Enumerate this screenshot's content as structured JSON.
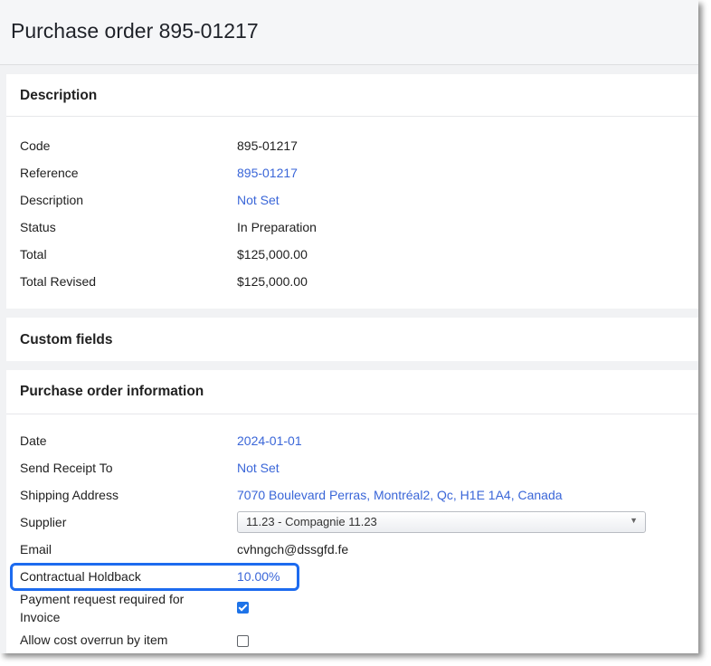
{
  "header": {
    "title": "Purchase order 895-01217"
  },
  "description": {
    "title": "Description",
    "rows": [
      {
        "label": "Code",
        "value": "895-01217"
      },
      {
        "label": "Reference",
        "value": "895-01217"
      },
      {
        "label": "Description",
        "value": "Not Set"
      },
      {
        "label": "Status",
        "value": "In Preparation"
      },
      {
        "label": "Total",
        "value": "$125,000.00"
      },
      {
        "label": "Total Revised",
        "value": "$125,000.00"
      }
    ]
  },
  "custom_fields": {
    "title": "Custom fields"
  },
  "po_info": {
    "title": "Purchase order information",
    "date": {
      "label": "Date",
      "value": "2024-01-01"
    },
    "send_receipt": {
      "label": "Send Receipt To",
      "value": "Not Set"
    },
    "shipping": {
      "label": "Shipping Address",
      "value": "7070 Boulevard Perras, Montréal2, Qc, H1E 1A4, Canada"
    },
    "supplier": {
      "label": "Supplier",
      "value": "11.23 - Compagnie 11.23"
    },
    "email": {
      "label": "Email",
      "value": "cvhngch@dssgfd.fe"
    },
    "holdback": {
      "label": "Contractual Holdback",
      "value": "10.00%"
    },
    "payment_request": {
      "label_line1": "Payment request required for",
      "label_line2": "Invoice",
      "checked": true
    },
    "cost_overrun": {
      "label": "Allow cost overrun by item",
      "checked": false
    }
  },
  "colors": {
    "link": "#3a66d8",
    "highlight": "#1d6bef",
    "checkbox": "#1e73e8"
  }
}
